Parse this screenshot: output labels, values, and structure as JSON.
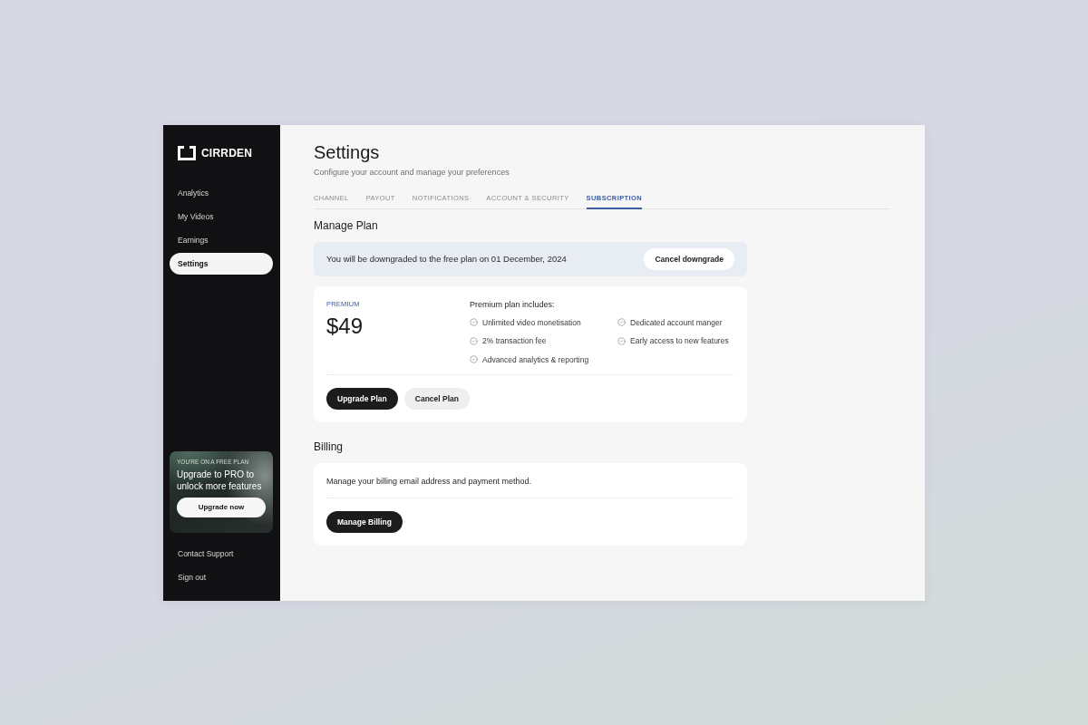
{
  "sidebar": {
    "logo": "CIRRDEN",
    "nav": [
      {
        "label": "Analytics",
        "selected": false
      },
      {
        "label": "My Videos",
        "selected": false
      },
      {
        "label": "Earnings",
        "selected": false
      },
      {
        "label": "Settings",
        "selected": true
      }
    ],
    "promo": {
      "eyebrow": "YOU'RE ON A FREE PLAN",
      "title": "Upgrade to PRO to unlock more features",
      "button": "Upgrade now"
    },
    "footer_links": [
      "Contact Support",
      "Sign out"
    ]
  },
  "header": {
    "title": "Settings",
    "subtitle": "Configure your account and manage your preferences"
  },
  "tabs": [
    {
      "label": "CHANNEL",
      "selected": false
    },
    {
      "label": "PAYOUT",
      "selected": false
    },
    {
      "label": "NOTIFICATIONS",
      "selected": false
    },
    {
      "label": "ACCOUNT & SECURITY",
      "selected": false
    },
    {
      "label": "SUBSCRIPTION",
      "selected": true
    }
  ],
  "manage_plan": {
    "heading": "Manage Plan",
    "notice": {
      "text": "You will be downgraded to the free plan on 01 December, 2024",
      "button": "Cancel downgrade"
    },
    "plan": {
      "tier": "PREMIUM",
      "price": "$49",
      "includes_title": "Premium plan includes:",
      "features": [
        "Unlimited video monetisation",
        "2% transaction fee",
        "Advanced analytics & reporting",
        "Dedicated account manger",
        "Early access to new features"
      ],
      "buttons": [
        {
          "label": "Upgrade Plan",
          "kind": "primary"
        },
        {
          "label": "Cancel Plan",
          "kind": "secondary"
        }
      ]
    }
  },
  "billing": {
    "heading": "Billing",
    "text": "Manage your billing email address and payment method.",
    "button": "Manage Billing"
  }
}
